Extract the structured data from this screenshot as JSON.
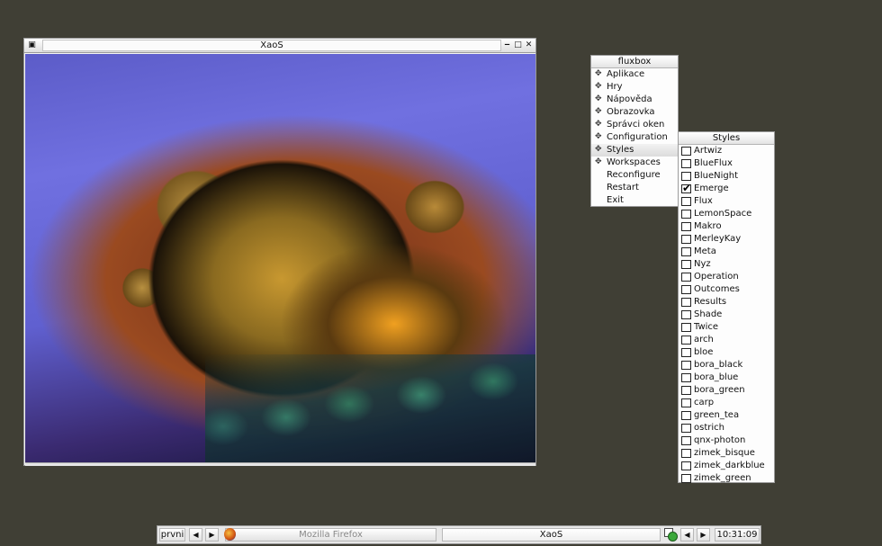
{
  "xaos_window": {
    "title": "XaoS",
    "menu_icon": "window-menu-icon",
    "buttons": {
      "minimize": "minimize-icon",
      "maximize": "maximize-icon",
      "close": "close-icon"
    }
  },
  "root_menu": {
    "title": "fluxbox",
    "items": [
      {
        "label": "Aplikace",
        "submenu": true
      },
      {
        "label": "Hry",
        "submenu": true
      },
      {
        "label": "Nápověda",
        "submenu": true
      },
      {
        "label": "Obrazovka",
        "submenu": true
      },
      {
        "label": "Správci oken",
        "submenu": true
      },
      {
        "label": "Configuration",
        "submenu": true
      },
      {
        "label": "Styles",
        "submenu": true,
        "active": true
      },
      {
        "label": "Workspaces",
        "submenu": true
      },
      {
        "label": "Reconfigure",
        "submenu": false
      },
      {
        "label": "Restart",
        "submenu": false
      },
      {
        "label": "Exit",
        "submenu": false
      }
    ]
  },
  "styles_menu": {
    "title": "Styles",
    "selected": "Emerge",
    "items": [
      "Artwiz",
      "BlueFlux",
      "BlueNight",
      "Emerge",
      "Flux",
      "LemonSpace",
      "Makro",
      "MerleyKay",
      "Meta",
      "Nyz",
      "Operation",
      "Outcomes",
      "Results",
      "Shade",
      "Twice",
      "arch",
      "bloe",
      "bora_black",
      "bora_blue",
      "bora_green",
      "carp",
      "green_tea",
      "ostrich",
      "qnx-photon",
      "zimek_bisque",
      "zimek_darkblue",
      "zimek_green"
    ]
  },
  "toolbar": {
    "workspace": "prvni",
    "prev_arrow": "◀",
    "next_arrow": "▶",
    "tasks": [
      {
        "label": "Mozilla Firefox",
        "icon": "firefox-icon",
        "active": false
      },
      {
        "label": "XaoS",
        "icon": "",
        "active": true
      }
    ],
    "clock": "10:31:09"
  },
  "colors": {
    "desktop": "#403f35",
    "menu_bg": "#fdfdfd",
    "fractal_sky": "#6868d8",
    "fractal_gold": "#c89830"
  }
}
